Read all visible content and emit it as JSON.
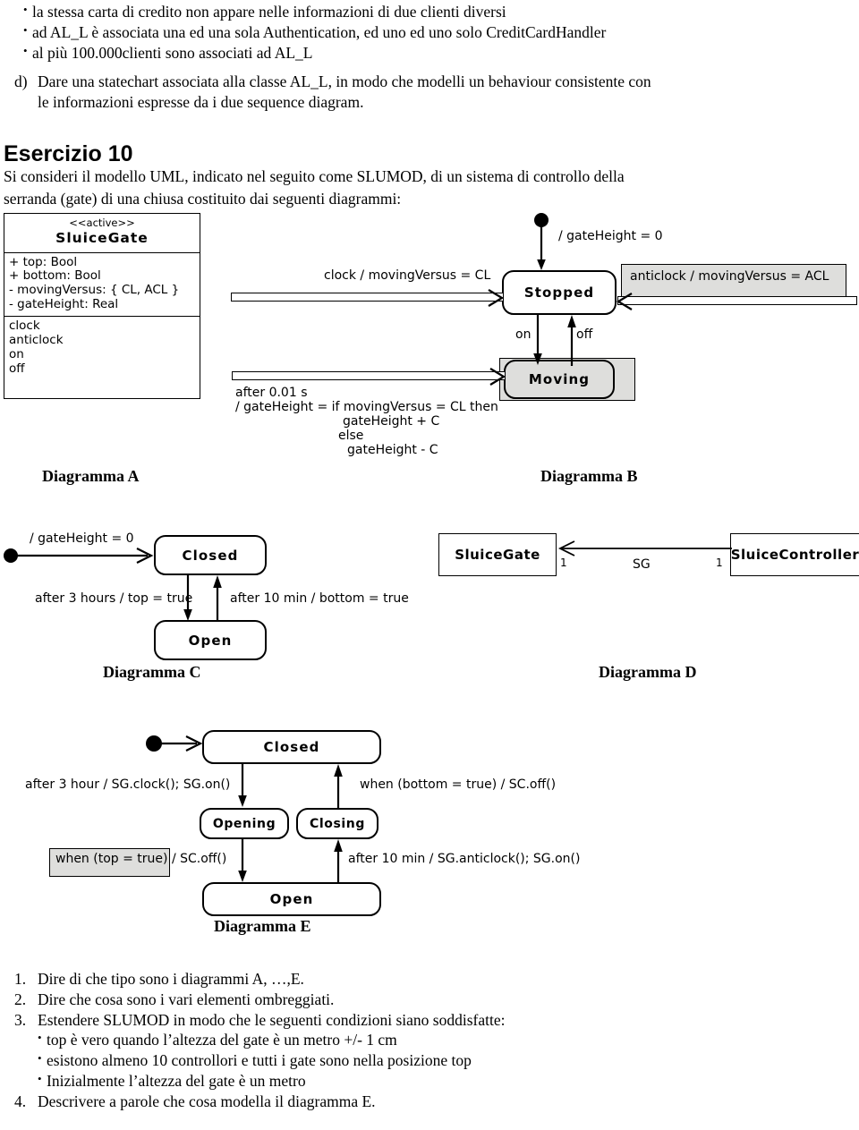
{
  "intro_bullets": [
    "la stessa carta di credito non appare nelle informazioni di due clienti diversi",
    "ad AL_L è associata una ed una sola Authentication, ed uno ed uno solo CreditCardHandler",
    "al più 100.000clienti sono associati ad AL_L"
  ],
  "item_d": {
    "marker": "d)",
    "line1": "Dare una statechart associata alla classe AL_L, in modo che modelli un behaviour consistente con",
    "line2": "le informazioni espresse da i due sequence diagram."
  },
  "esercizio": {
    "heading": "Esercizio 10",
    "line1": "Si consideri il modello UML, indicato nel seguito come SLUMOD, di un sistema di controllo della",
    "line2": "serranda (gate) di una chiusa costituito dai seguenti diagrammi:"
  },
  "diagram_a": {
    "caption": "Diagramma A",
    "stereotype": "<<active>>",
    "class_name": "SluiceGate",
    "attributes": [
      "+ top: Bool",
      "+ bottom: Bool",
      "- movingVersus: { CL, ACL }",
      "- gateHeight: Real"
    ],
    "operations": [
      "clock",
      "anticlock",
      "on",
      "off"
    ]
  },
  "diagram_b": {
    "caption": "Diagramma B",
    "initial_label": "/ gateHeight = 0",
    "state_stopped": "Stopped",
    "state_moving": "Moving",
    "t_clock": "clock / movingVersus = CL",
    "t_anticlock": "anticlock / movingVersus = ACL",
    "t_on": "on",
    "t_off": "off",
    "t_after_line1": "after 0.01 s",
    "t_after_line2": "/ gateHeight = if movingVersus = CL then",
    "t_after_line3": "gateHeight + C",
    "t_after_line4": "else",
    "t_after_line5": "gateHeight - C"
  },
  "diagram_c": {
    "caption": "Diagramma C",
    "initial_label": "/ gateHeight = 0",
    "state_closed": "Closed",
    "state_open": "Open",
    "t_down": "after 3 hours / top = true",
    "t_up": "after 10 min / bottom = true"
  },
  "diagram_d": {
    "caption": "Diagramma D",
    "class_left": "SluiceGate",
    "class_right": "SluiceController",
    "mult_left": "1",
    "mult_right": "1",
    "assoc_name": "SG"
  },
  "diagram_e": {
    "caption": "Diagramma E",
    "state_closed": "Closed",
    "state_opening": "Opening",
    "state_closing": "Closing",
    "state_open": "Open",
    "t_closed_opening": "after 3 hour / SG.clock(); SG.on()",
    "t_opening_open": "when (top = true) /  SC.off()",
    "t_closing_closed": "when (bottom = true) /  SC.off()",
    "t_open_closing": "after 10 min / SG.anticlock(); SG.on()"
  },
  "questions": [
    {
      "num": "1.",
      "text": "Dire di che tipo sono i diagrammi A, …,E."
    },
    {
      "num": "2.",
      "text": "Dire che cosa sono i vari elementi ombreggiati."
    },
    {
      "num": "3.",
      "text": "Estendere SLUMOD in modo che le seguenti condizioni siano soddisfatte:"
    },
    {
      "num": "4.",
      "text": "Descrivere a parole che cosa modella il diagramma E."
    }
  ],
  "q3_bullets": [
    "top è vero quando l’altezza del gate è un metro +/- 1 cm",
    "esistono almeno 10 controllori e tutti i gate sono nella posizione top",
    "Inizialmente l’altezza del gate è un metro"
  ],
  "colors": {
    "shade": "#dededc",
    "line": "#000000",
    "page": "#ffffff"
  }
}
